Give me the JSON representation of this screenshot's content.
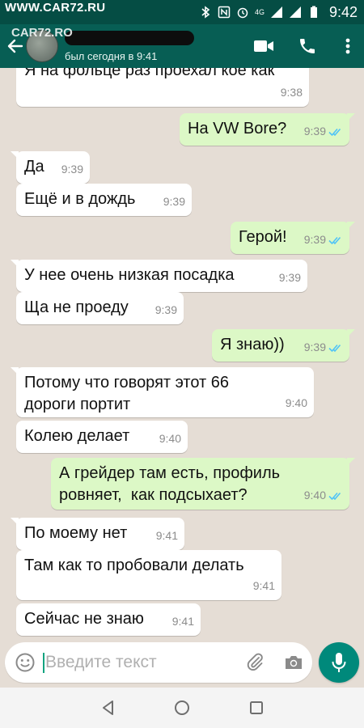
{
  "status_bar": {
    "watermark": "WWW.CAR72.RU",
    "time": "9:42",
    "network": "4G"
  },
  "header": {
    "watermark_logo": "CAR72.RO",
    "last_seen": "был сегодня в 9:41"
  },
  "messages": [
    {
      "dir": "in",
      "text": "Я на фольце раз проехал кое как",
      "time": "9:38"
    },
    {
      "dir": "out",
      "text": "На VW Bore?",
      "time": "9:39"
    },
    {
      "dir": "in",
      "text": "Да",
      "time": "9:39"
    },
    {
      "dir": "in",
      "text": "Ещё и в дождь",
      "time": "9:39"
    },
    {
      "dir": "out",
      "text": "Герой!",
      "time": "9:39"
    },
    {
      "dir": "in",
      "text": "У нее очень низкая посадка",
      "time": "9:39"
    },
    {
      "dir": "in",
      "text": "Ща не проеду",
      "time": "9:39"
    },
    {
      "dir": "out",
      "text": "Я знаю))",
      "time": "9:39"
    },
    {
      "dir": "in",
      "text": "Потому что говорят этот 66\nдороги портит",
      "time": "9:40"
    },
    {
      "dir": "in",
      "text": "Колею делает",
      "time": "9:40"
    },
    {
      "dir": "out",
      "text": "А грейдер там есть, профиль\nровняет,  как подсыхает?",
      "time": "9:40"
    },
    {
      "dir": "in",
      "text": "По моему нет",
      "time": "9:41"
    },
    {
      "dir": "in",
      "text": "Там как то пробовали делать",
      "time": "9:41"
    },
    {
      "dir": "in",
      "text": "Сейчас не знаю",
      "time": "9:41"
    }
  ],
  "composer": {
    "placeholder": "Введите текст"
  },
  "colors": {
    "header": "#075e54",
    "status_bar": "#054d44",
    "bubble_out": "#dcf8c6",
    "bubble_in": "#ffffff",
    "chat_bg": "#e5ddd5",
    "read_ticks": "#4fc3f7",
    "mic_button": "#00897b"
  },
  "icons": [
    "back-arrow-icon",
    "video-call-icon",
    "phone-icon",
    "more-vert-icon",
    "emoji-icon",
    "attach-icon",
    "camera-icon",
    "mic-icon",
    "nav-back-icon",
    "nav-home-icon",
    "nav-recents-icon"
  ]
}
